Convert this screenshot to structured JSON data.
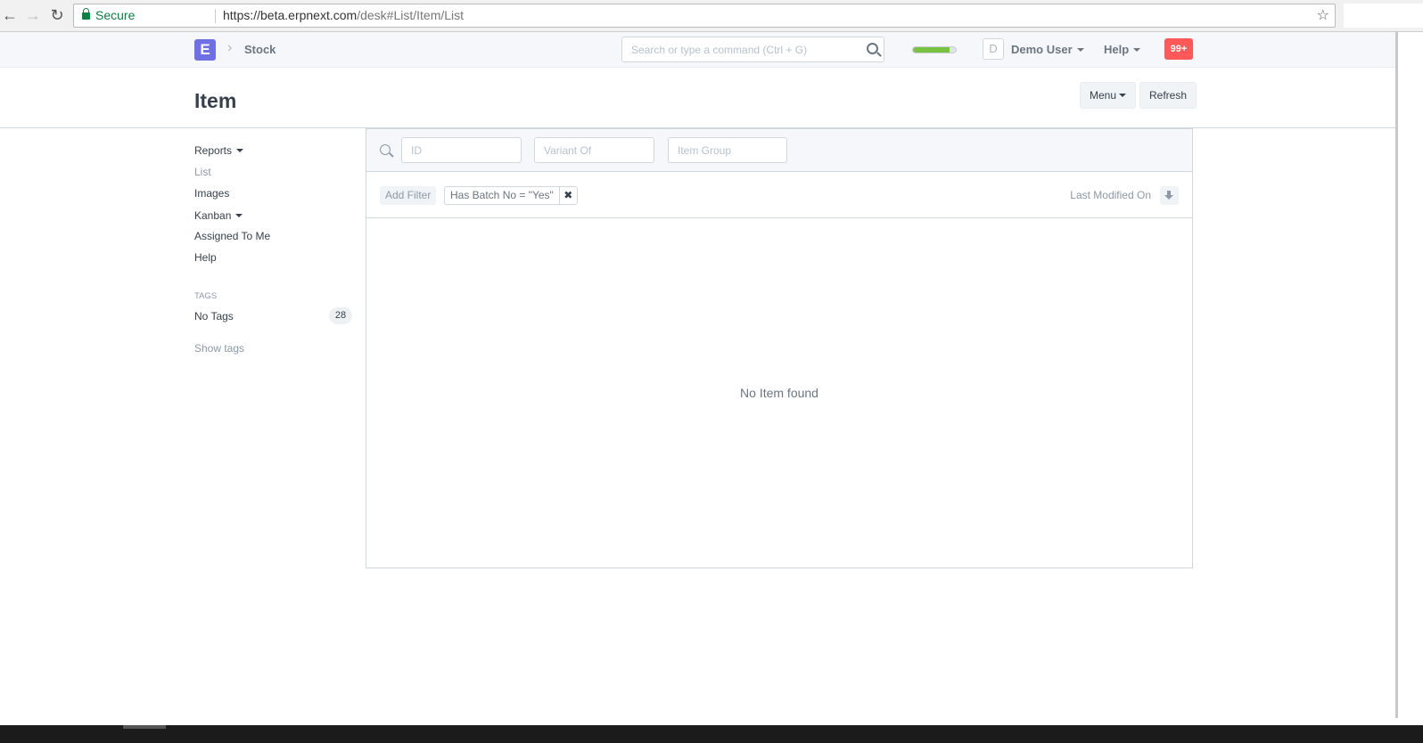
{
  "browser": {
    "secure_label": "Secure",
    "url_host": "https://beta.erpnext.com",
    "url_path": "/desk#List/Item/List"
  },
  "navbar": {
    "logo_letter": "E",
    "breadcrumb": "Stock",
    "search_placeholder": "Search or type a command (Ctrl + G)",
    "progress_fraction": 0.85,
    "avatar_letter": "D",
    "user_label": "Demo User",
    "help_label": "Help",
    "notifications": "99+"
  },
  "page": {
    "title": "Item",
    "menu_label": "Menu",
    "refresh_label": "Refresh"
  },
  "sidebar": {
    "reports": "Reports",
    "list": "List",
    "images": "Images",
    "kanban": "Kanban",
    "assigned": "Assigned To Me",
    "help": "Help",
    "tags_heading": "TAGS",
    "no_tags": "No Tags",
    "no_tags_count": "28",
    "show_tags": "Show tags"
  },
  "list": {
    "filter_id_placeholder": "ID",
    "filter_variant_placeholder": "Variant Of",
    "filter_group_placeholder": "Item Group",
    "add_filter": "Add Filter",
    "active_filter": "Has Batch No = \"Yes\"",
    "sort_label": "Last Modified On",
    "empty_message": "No Item found"
  },
  "colors": {
    "accent": "#6f6fe6",
    "notification": "#ff5858",
    "progress": "#78c342"
  }
}
